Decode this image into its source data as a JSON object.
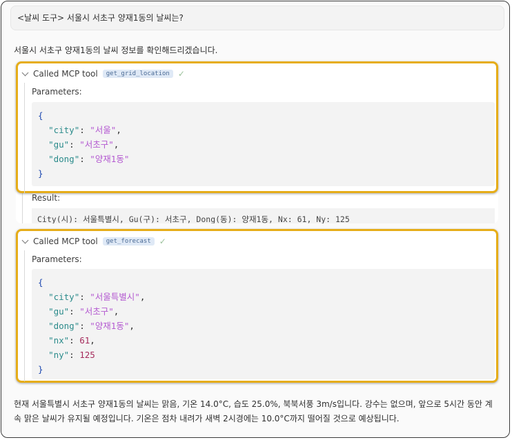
{
  "user_message": "<날씨 도구> 서울시 서초구 양재1동의 날씨는?",
  "assistant_intro": "서울시 서초구 양재1동의 날씨 정보를 확인해드리겠습니다.",
  "tool_calls": [
    {
      "header": "Called MCP tool",
      "tool_name": "get_grid_location",
      "params_label": "Parameters:",
      "params": {
        "open": "{",
        "close": "}",
        "city_key": "\"city\"",
        "city_val": "\"서울\"",
        "gu_key": "\"gu\"",
        "gu_val": "\"서초구\"",
        "dong_key": "\"dong\"",
        "dong_val": "\"양재1동\""
      },
      "result_label": "Result:",
      "result_text": "City(시): 서울특별시, Gu(구): 서초구, Dong(동): 양재1동, Nx: 61, Ny: 125"
    },
    {
      "header": "Called MCP tool",
      "tool_name": "get_forecast",
      "params_label": "Parameters:",
      "params": {
        "open": "{",
        "close": "}",
        "city_key": "\"city\"",
        "city_val": "\"서울특별시\"",
        "gu_key": "\"gu\"",
        "gu_val": "\"서초구\"",
        "dong_key": "\"dong\"",
        "dong_val": "\"양재1동\"",
        "nx_key": "\"nx\"",
        "nx_val": "61",
        "ny_key": "\"ny\"",
        "ny_val": "125"
      }
    }
  ],
  "final_answer_line1": "현재 서울특별시 서초구 양재1동의 날씨는 맑음, 기온 14.0°C, 습도 25.0%, 북북서풍 3m/s입니다. 강수는 없으며, 앞으로 5시간 동안 계",
  "final_answer_line2": "속 맑은 날씨가 유지될 예정입니다. 기온은 점차 내려가 새벽 2시경에는 10.0°C까지 떨어질 것으로 예상됩니다.",
  "icons": {
    "collapse": "chevron-down-icon",
    "success": "checkmark-icon"
  },
  "colors": {
    "highlight_border": "#e6ad18",
    "tool_badge_bg": "#dfe9f6",
    "json_key": "#2b8b8b",
    "json_string": "#b45ad1",
    "json_number": "#a52b5c",
    "json_brace": "#1d48b0"
  }
}
